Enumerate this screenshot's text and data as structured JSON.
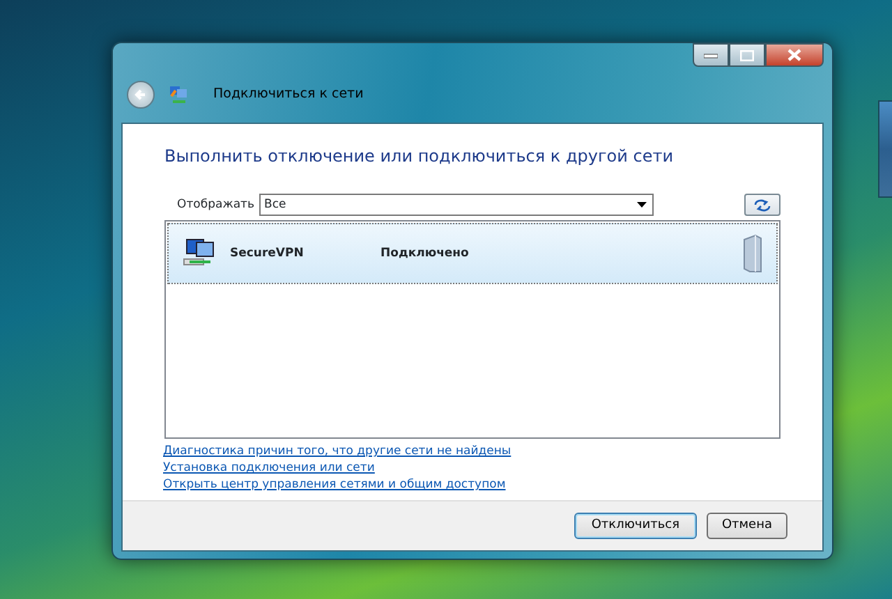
{
  "window": {
    "title": "Подключиться к сети"
  },
  "heading": "Выполнить отключение или подключиться к другой сети",
  "filter": {
    "label": "Отображать",
    "value": "Все"
  },
  "connections": [
    {
      "name": "SecureVPN",
      "status": "Подключено",
      "selected": true
    }
  ],
  "links": [
    "Диагностика причин того, что другие сети не найдены",
    "Установка подключения или сети",
    "Открыть центр управления сетями и общим доступом"
  ],
  "buttons": [
    {
      "label": "Отключиться",
      "default": true
    },
    {
      "label": "Отмена",
      "default": false
    }
  ]
}
